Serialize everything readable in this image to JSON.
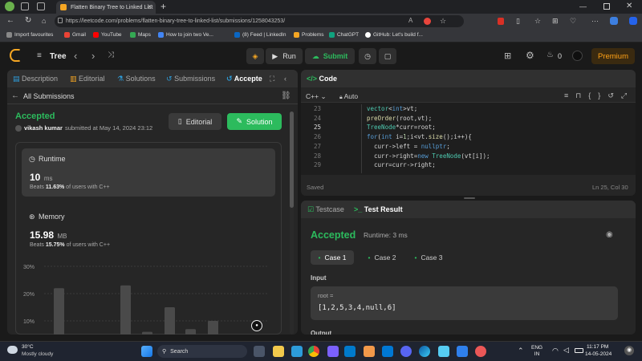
{
  "browser": {
    "tab_title": "Flatten Binary Tree to Linked List",
    "url": "https://leetcode.com/problems/flatten-binary-tree-to-linked-list/submissions/1258043253/",
    "new_tab": "+"
  },
  "bookmarks": [
    {
      "label": "Import favourites",
      "color": "#888888"
    },
    {
      "label": "Gmail",
      "color": "#ea4335"
    },
    {
      "label": "YouTube",
      "color": "#ff0000"
    },
    {
      "label": "Maps",
      "color": "#34a853"
    },
    {
      "label": "How to join two Ve...",
      "color": "#4285f4"
    },
    {
      "label": "(8) Feed | LinkedIn",
      "color": "#0a66c2"
    },
    {
      "label": "Problems",
      "color": "#f5a623"
    },
    {
      "label": "ChatGPT",
      "color": "#10a37f"
    },
    {
      "label": "GitHub: Let's build f...",
      "color": "#ffffff"
    }
  ],
  "lc": {
    "problem_list": "Tree",
    "run": "Run",
    "submit": "Submit",
    "coins": "0",
    "premium": "Premium"
  },
  "left": {
    "tabs": [
      "Description",
      "Editorial",
      "Solutions",
      "Submissions",
      "Accepte"
    ],
    "back": "All Submissions",
    "status": "Accepted",
    "user": "vikash kumar",
    "submitted": "submitted at May 14, 2024 23:12",
    "editorial_btn": "Editorial",
    "solution_btn": "Solution",
    "runtime_label": "Runtime",
    "runtime_value": "10",
    "runtime_unit": "ms",
    "runtime_beats_pre": "Beats",
    "runtime_beats": "11.63%",
    "runtime_beats_post": "of users with C++",
    "memory_label": "Memory",
    "memory_value": "15.98",
    "memory_unit": "MB",
    "memory_beats_pre": "Beats",
    "memory_beats": "15.75%",
    "memory_beats_post": "of users with C++"
  },
  "chart_data": {
    "type": "bar",
    "ytick_labels": [
      "30%",
      "20%",
      "10%"
    ],
    "yticks": [
      30,
      20,
      10
    ],
    "values": [
      22,
      23,
      6,
      15,
      7,
      10
    ],
    "ylim": [
      8,
      30
    ]
  },
  "code": {
    "title": "Code",
    "lang": "C++",
    "mode": "Auto",
    "lines": [
      {
        "n": "23",
        "t": "vector<int>vt;"
      },
      {
        "n": "24",
        "t": "preOrder(root,vt);"
      },
      {
        "n": "25",
        "t": "TreeNode*curr=root;"
      },
      {
        "n": "26",
        "t": "for(int i=1;i<vt.size();i++){"
      },
      {
        "n": "27",
        "t": "  curr->left = nullptr;"
      },
      {
        "n": "28",
        "t": "  curr->right=new TreeNode(vt[i]);"
      },
      {
        "n": "29",
        "t": "  curr=curr->right;"
      }
    ],
    "saved": "Saved",
    "cursor": "Ln 25, Col 30"
  },
  "result": {
    "tab_testcase": "Testcase",
    "tab_result": "Test Result",
    "status": "Accepted",
    "runtime": "Runtime: 3 ms",
    "cases": [
      "Case 1",
      "Case 2",
      "Case 3"
    ],
    "input_label": "Input",
    "var_name": "root =",
    "var_value": "[1,2,5,3,4,null,6]",
    "output_label": "Output"
  },
  "taskbar": {
    "temp": "30°C",
    "weather": "Mostly cloudy",
    "search": "Search",
    "lang1": "ENG",
    "lang2": "IN",
    "time": "11:17 PM",
    "date": "14-05-2024"
  }
}
